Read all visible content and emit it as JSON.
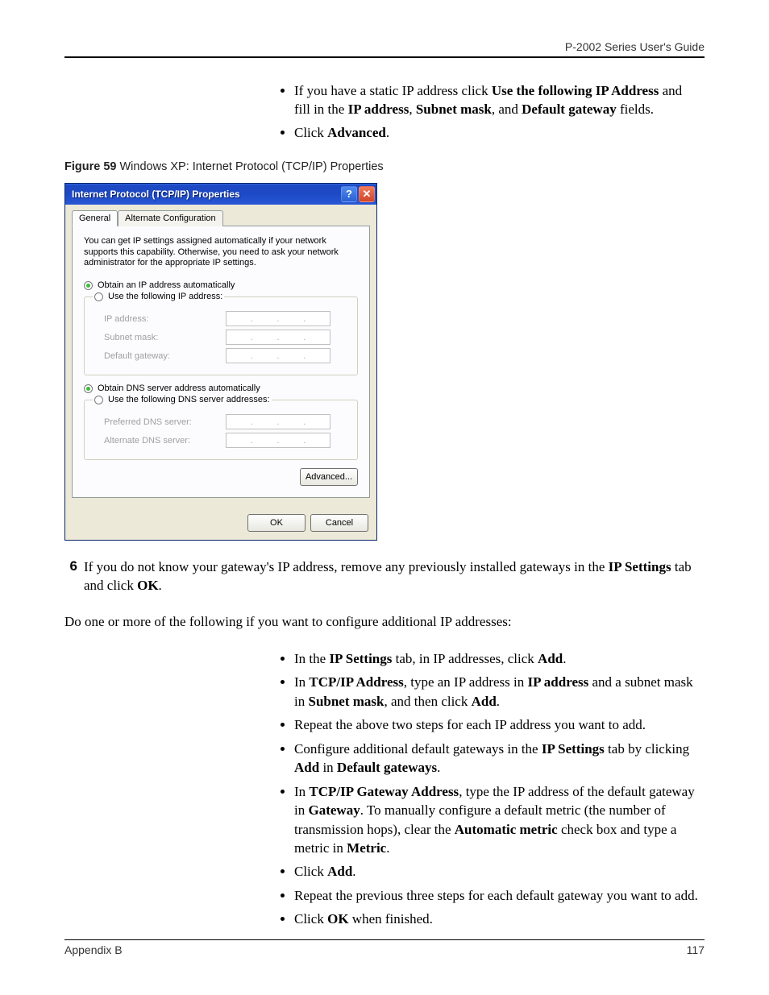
{
  "header": {
    "guide_title": "P-2002 Series User's Guide"
  },
  "top_bullets": {
    "b1_pre": "If you have a static IP address click ",
    "b1_strong1": "Use the following IP Address",
    "b1_mid": " and fill in the ",
    "b1_strong2": "IP address",
    "b1_sep1": ", ",
    "b1_strong3": "Subnet mask",
    "b1_sep2": ", and ",
    "b1_strong4": "Default gateway",
    "b1_post": " fields.",
    "b2_pre": "Click ",
    "b2_strong": "Advanced",
    "b2_post": "."
  },
  "figure": {
    "label": "Figure 59",
    "caption": "   Windows XP: Internet Protocol (TCP/IP) Properties"
  },
  "dialog": {
    "title": "Internet Protocol (TCP/IP) Properties",
    "tabs": {
      "general": "General",
      "alt": "Alternate Configuration"
    },
    "desc": "You can get IP settings assigned automatically if your network supports this capability. Otherwise, you need to ask your network administrator for the appropriate IP settings.",
    "radio_ip_auto": "Obtain an IP address automatically",
    "radio_ip_manual": "Use the following IP address:",
    "lbl_ip": "IP address:",
    "lbl_subnet": "Subnet mask:",
    "lbl_gateway": "Default gateway:",
    "radio_dns_auto": "Obtain DNS server address automatically",
    "radio_dns_manual": "Use the following DNS server addresses:",
    "lbl_dns_pref": "Preferred DNS server:",
    "lbl_dns_alt": "Alternate DNS server:",
    "btn_advanced": "Advanced...",
    "btn_ok": "OK",
    "btn_cancel": "Cancel"
  },
  "step6": {
    "num": "6",
    "pre": "If you do not know your gateway's IP address, remove any previously installed gateways in the ",
    "s1": "IP Settings",
    "mid": " tab and click ",
    "s2": "OK",
    "post": "."
  },
  "para1": "Do one or more of the following if you want to configure additional IP addresses:",
  "bottom_bullets": {
    "bb1_pre": "In the ",
    "bb1_s1": "IP Settings",
    "bb1_mid": " tab, in IP addresses, click ",
    "bb1_s2": "Add",
    "bb1_post": ".",
    "bb2_pre": "In ",
    "bb2_s1": "TCP/IP Address",
    "bb2_mid1": ", type an IP address in ",
    "bb2_s2": "IP address",
    "bb2_mid2": " and a subnet mask in ",
    "bb2_s3": "Subnet mask",
    "bb2_mid3": ", and then click ",
    "bb2_s4": "Add",
    "bb2_post": ".",
    "bb3": "Repeat the above two steps for each IP address you want to add.",
    "bb4_pre": "Configure additional default gateways in the ",
    "bb4_s1": "IP Settings",
    "bb4_mid": " tab by clicking ",
    "bb4_s2": "Add",
    "bb4_mid2": " in ",
    "bb4_s3": "Default gateways",
    "bb4_post": ".",
    "bb5_pre": "In ",
    "bb5_s1": "TCP/IP Gateway Address",
    "bb5_mid1": ", type the IP address of the default gateway in ",
    "bb5_s2": "Gateway",
    "bb5_mid2": ". To manually configure a default metric (the number of transmission hops), clear the ",
    "bb5_s3": "Automatic metric",
    "bb5_mid3": " check box and type a metric in ",
    "bb5_s4": "Metric",
    "bb5_post": ".",
    "bb6_pre": "Click ",
    "bb6_s1": "Add",
    "bb6_post": ".",
    "bb7": "Repeat the previous three steps for each default gateway you want to add.",
    "bb8_pre": "Click ",
    "bb8_s1": "OK",
    "bb8_post": " when finished."
  },
  "footer": {
    "left": "Appendix B",
    "right": "117"
  }
}
